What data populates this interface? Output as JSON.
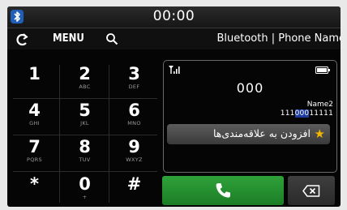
{
  "status_bar": {
    "time": "00:00",
    "bluetooth_icon": "bluetooth-phone-icon"
  },
  "nav": {
    "back_icon": "back-arrow-icon",
    "menu_label": "MENU",
    "search_icon": "search-icon",
    "title": "Bluetooth | Phone Name"
  },
  "keypad": {
    "keys": [
      {
        "digit": "1",
        "letters": ""
      },
      {
        "digit": "2",
        "letters": "ABC"
      },
      {
        "digit": "3",
        "letters": "DEF"
      },
      {
        "digit": "4",
        "letters": "GHI"
      },
      {
        "digit": "5",
        "letters": "JKL"
      },
      {
        "digit": "6",
        "letters": "MNO"
      },
      {
        "digit": "7",
        "letters": "PQRS"
      },
      {
        "digit": "8",
        "letters": "TUV"
      },
      {
        "digit": "9",
        "letters": "WXYZ"
      },
      {
        "digit": "*",
        "letters": ""
      },
      {
        "digit": "0",
        "letters": "+"
      },
      {
        "digit": "#",
        "letters": ""
      }
    ]
  },
  "panel": {
    "signal_icon": "signal-strength-icon",
    "battery_icon": "battery-icon",
    "dialed_number": "000",
    "contact_name": "Name2",
    "contact_number_prefix": "111",
    "contact_number_match": "000",
    "contact_number_suffix": "11111",
    "favorite_label": "افزودن به علاقه‌مندی‌ها",
    "favorite_icon": "star-icon"
  },
  "actions": {
    "call_icon": "phone-handset-icon",
    "delete_icon": "backspace-icon"
  },
  "colors": {
    "call_green": "#1f8a2a",
    "star_yellow": "#f2b500",
    "match_highlight": "#1d3b9e",
    "bluetooth_blue": "#1f5fb8"
  }
}
